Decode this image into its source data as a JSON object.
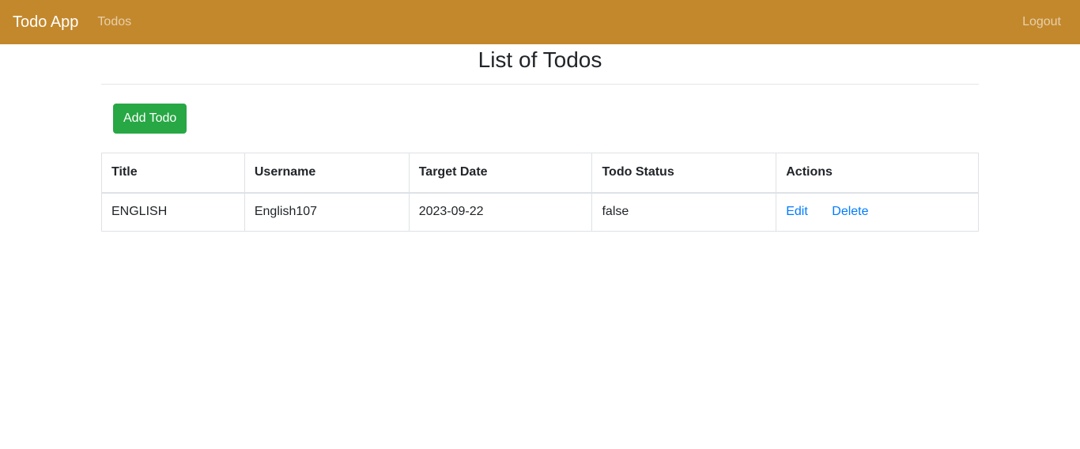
{
  "navbar": {
    "brand": "Todo App",
    "links": [
      {
        "label": "Todos"
      }
    ],
    "logout_label": "Logout"
  },
  "page": {
    "title": "List of Todos",
    "add_button_label": "Add Todo"
  },
  "table": {
    "headers": [
      "Title",
      "Username",
      "Target Date",
      "Todo Status",
      "Actions"
    ],
    "rows": [
      {
        "title": "ENGLISH",
        "username": "English107",
        "target_date": "2023-09-22",
        "status": "false",
        "actions": {
          "edit": "Edit",
          "delete": "Delete"
        }
      }
    ]
  },
  "colors": {
    "navbar": "#c3882c",
    "add_button": "#28a745",
    "link": "#007bff"
  }
}
